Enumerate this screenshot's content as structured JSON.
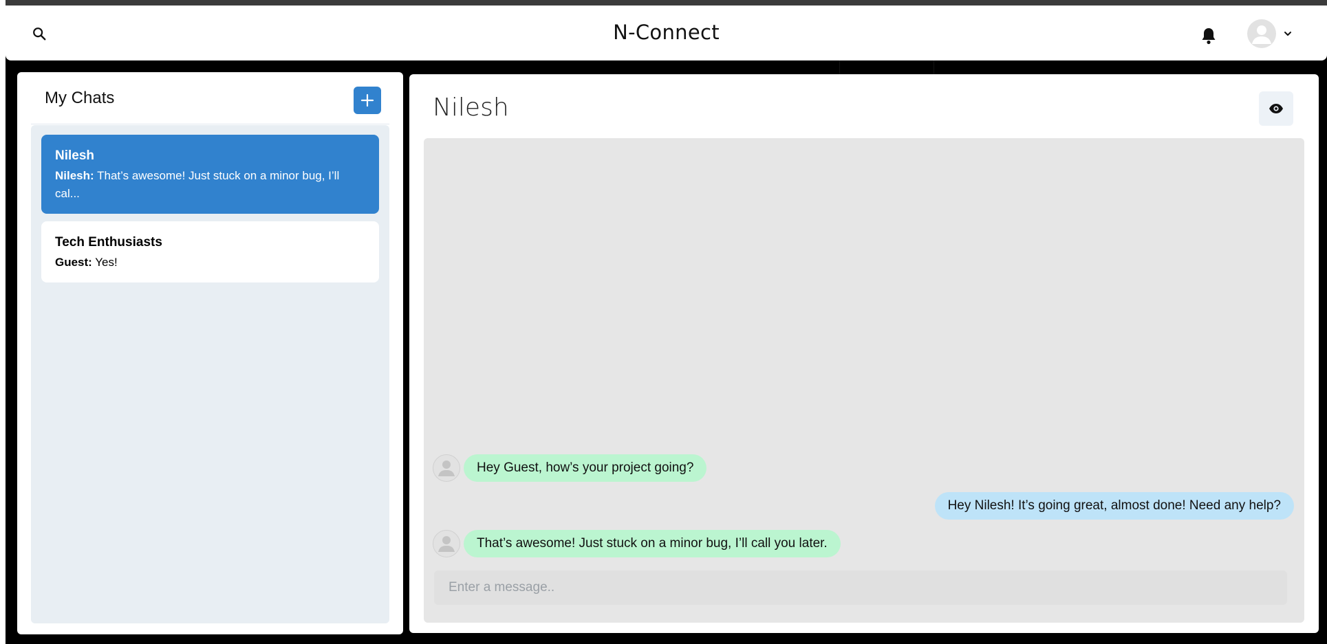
{
  "header": {
    "title": "N-Connect",
    "search_icon": "search-icon",
    "bell_icon": "bell-icon",
    "avatar_icon": "user-avatar-icon",
    "chevron_icon": "chevron-down-icon"
  },
  "sidebar": {
    "title": "My Chats",
    "add_icon": "plus-icon",
    "chats": [
      {
        "name": "Nilesh",
        "sender": "Nilesh:",
        "preview": "That’s awesome! Just stuck on a minor bug, I’ll cal...",
        "active": true
      },
      {
        "name": "Tech Enthusiasts",
        "sender": "Guest:",
        "preview": "Yes!",
        "active": false
      }
    ]
  },
  "chat": {
    "title": "Nilesh",
    "view_icon": "eye-icon",
    "messages": [
      {
        "direction": "in",
        "text": "Hey Guest, how’s your project going?"
      },
      {
        "direction": "out",
        "text": "Hey Nilesh! It’s going great, almost done! Need any help?"
      },
      {
        "direction": "in",
        "text": "That’s awesome! Just stuck on a minor bug, I’ll call you later."
      }
    ],
    "input_placeholder": "Enter a message.."
  },
  "colors": {
    "accent": "#3182ce",
    "incoming_bubble": "#bbf5d0",
    "outgoing_bubble": "#bee3f8",
    "chat_background": "#e6e6e6",
    "list_background": "#e8eef3"
  }
}
